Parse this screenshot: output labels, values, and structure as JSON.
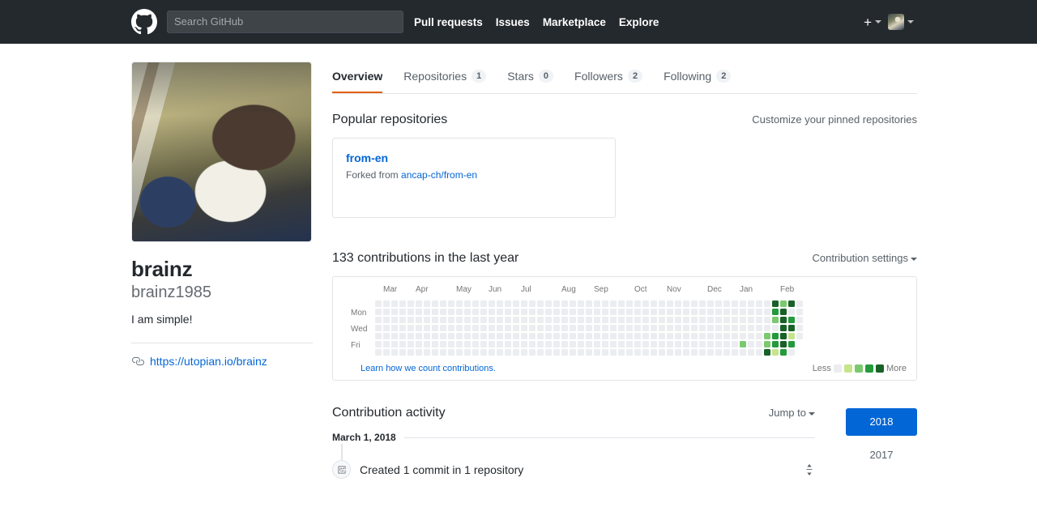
{
  "header": {
    "logo_icon": "github-mark-icon",
    "search_placeholder": "Search GitHub",
    "search_value": "",
    "nav": [
      {
        "label": "Pull requests"
      },
      {
        "label": "Issues"
      },
      {
        "label": "Marketplace"
      },
      {
        "label": "Explore"
      }
    ],
    "create_new_icon": "plus-icon",
    "account_icon": "avatar"
  },
  "profile": {
    "avatar_alt": "user-avatar-photo",
    "name": "brainz",
    "login": "brainz1985",
    "bio": "I am simple!",
    "link_icon": "link-icon",
    "website": "https://utopian.io/brainz"
  },
  "tabs": [
    {
      "label": "Overview",
      "count": null,
      "active": true
    },
    {
      "label": "Repositories",
      "count": "1",
      "active": false
    },
    {
      "label": "Stars",
      "count": "0",
      "active": false
    },
    {
      "label": "Followers",
      "count": "2",
      "active": false
    },
    {
      "label": "Following",
      "count": "2",
      "active": false
    }
  ],
  "popular_repositories": {
    "title": "Popular repositories",
    "customize_label": "Customize your pinned repositories",
    "cards": [
      {
        "name": "from-en",
        "forked_prefix": "Forked from",
        "forked_source": "ancap-ch/from-en"
      }
    ]
  },
  "contributions": {
    "heading": "133 contributions in the last year",
    "settings_label": "Contribution settings",
    "learn_more": "Learn how we count contributions.",
    "legend_less": "Less",
    "legend_more": "More",
    "months": [
      "Mar",
      "Apr",
      "May",
      "Jun",
      "Jul",
      "Aug",
      "Sep",
      "Oct",
      "Nov",
      "Dec",
      "Jan",
      "Feb"
    ],
    "days": [
      "Mon",
      "Wed",
      "Fri"
    ],
    "scale_colors": [
      "#ebedf0",
      "#c6e48b",
      "#7bc96f",
      "#239a3b",
      "#196127"
    ],
    "total": 133,
    "chart_data": {
      "type": "heatmap",
      "title": "133 contributions in the last year",
      "xlabel": "",
      "ylabel": "",
      "weeks": 53,
      "days_per_week": 7,
      "level_colors": [
        "#ebedf0",
        "#c6e48b",
        "#7bc96f",
        "#239a3b",
        "#196127"
      ],
      "month_labels": [
        "Mar",
        "Apr",
        "May",
        "Jun",
        "Jul",
        "Aug",
        "Sep",
        "Oct",
        "Nov",
        "Dec",
        "Jan",
        "Feb"
      ],
      "month_label_week_index": [
        1,
        5,
        10,
        14,
        18,
        23,
        27,
        32,
        36,
        41,
        45,
        50
      ],
      "day_labels": [
        "",
        "Mon",
        "",
        "Wed",
        "",
        "Fri",
        ""
      ],
      "active_cells": [
        {
          "week": 45,
          "day": 5,
          "level": 2
        },
        {
          "week": 48,
          "day": 4,
          "level": 2
        },
        {
          "week": 48,
          "day": 5,
          "level": 2
        },
        {
          "week": 48,
          "day": 6,
          "level": 4
        },
        {
          "week": 49,
          "day": 0,
          "level": 4
        },
        {
          "week": 49,
          "day": 1,
          "level": 3
        },
        {
          "week": 49,
          "day": 2,
          "level": 2
        },
        {
          "week": 49,
          "day": 4,
          "level": 3
        },
        {
          "week": 49,
          "day": 5,
          "level": 3
        },
        {
          "week": 49,
          "day": 6,
          "level": 1
        },
        {
          "week": 50,
          "day": 0,
          "level": 2
        },
        {
          "week": 50,
          "day": 1,
          "level": 4
        },
        {
          "week": 50,
          "day": 2,
          "level": 4
        },
        {
          "week": 50,
          "day": 3,
          "level": 4
        },
        {
          "week": 50,
          "day": 4,
          "level": 4
        },
        {
          "week": 50,
          "day": 5,
          "level": 4
        },
        {
          "week": 50,
          "day": 6,
          "level": 3
        },
        {
          "week": 51,
          "day": 0,
          "level": 4
        },
        {
          "week": 51,
          "day": 2,
          "level": 3
        },
        {
          "week": 51,
          "day": 3,
          "level": 4
        },
        {
          "week": 51,
          "day": 4,
          "level": 1
        },
        {
          "week": 51,
          "day": 5,
          "level": 3
        }
      ]
    }
  },
  "activity": {
    "title": "Contribution activity",
    "jump_to": "Jump to",
    "date": "March 1, 2018",
    "commit_icon": "commit-icon",
    "item_text": "Created 1 commit in 1 repository",
    "collapse_icon": "collapse-icon",
    "years": [
      {
        "label": "2018",
        "active": true
      },
      {
        "label": "2017",
        "active": false
      }
    ]
  },
  "colors": {
    "header_bg": "#24292e",
    "link": "#0366d6",
    "tab_active_underline": "#e36209",
    "year_active_bg": "#0366d6"
  }
}
